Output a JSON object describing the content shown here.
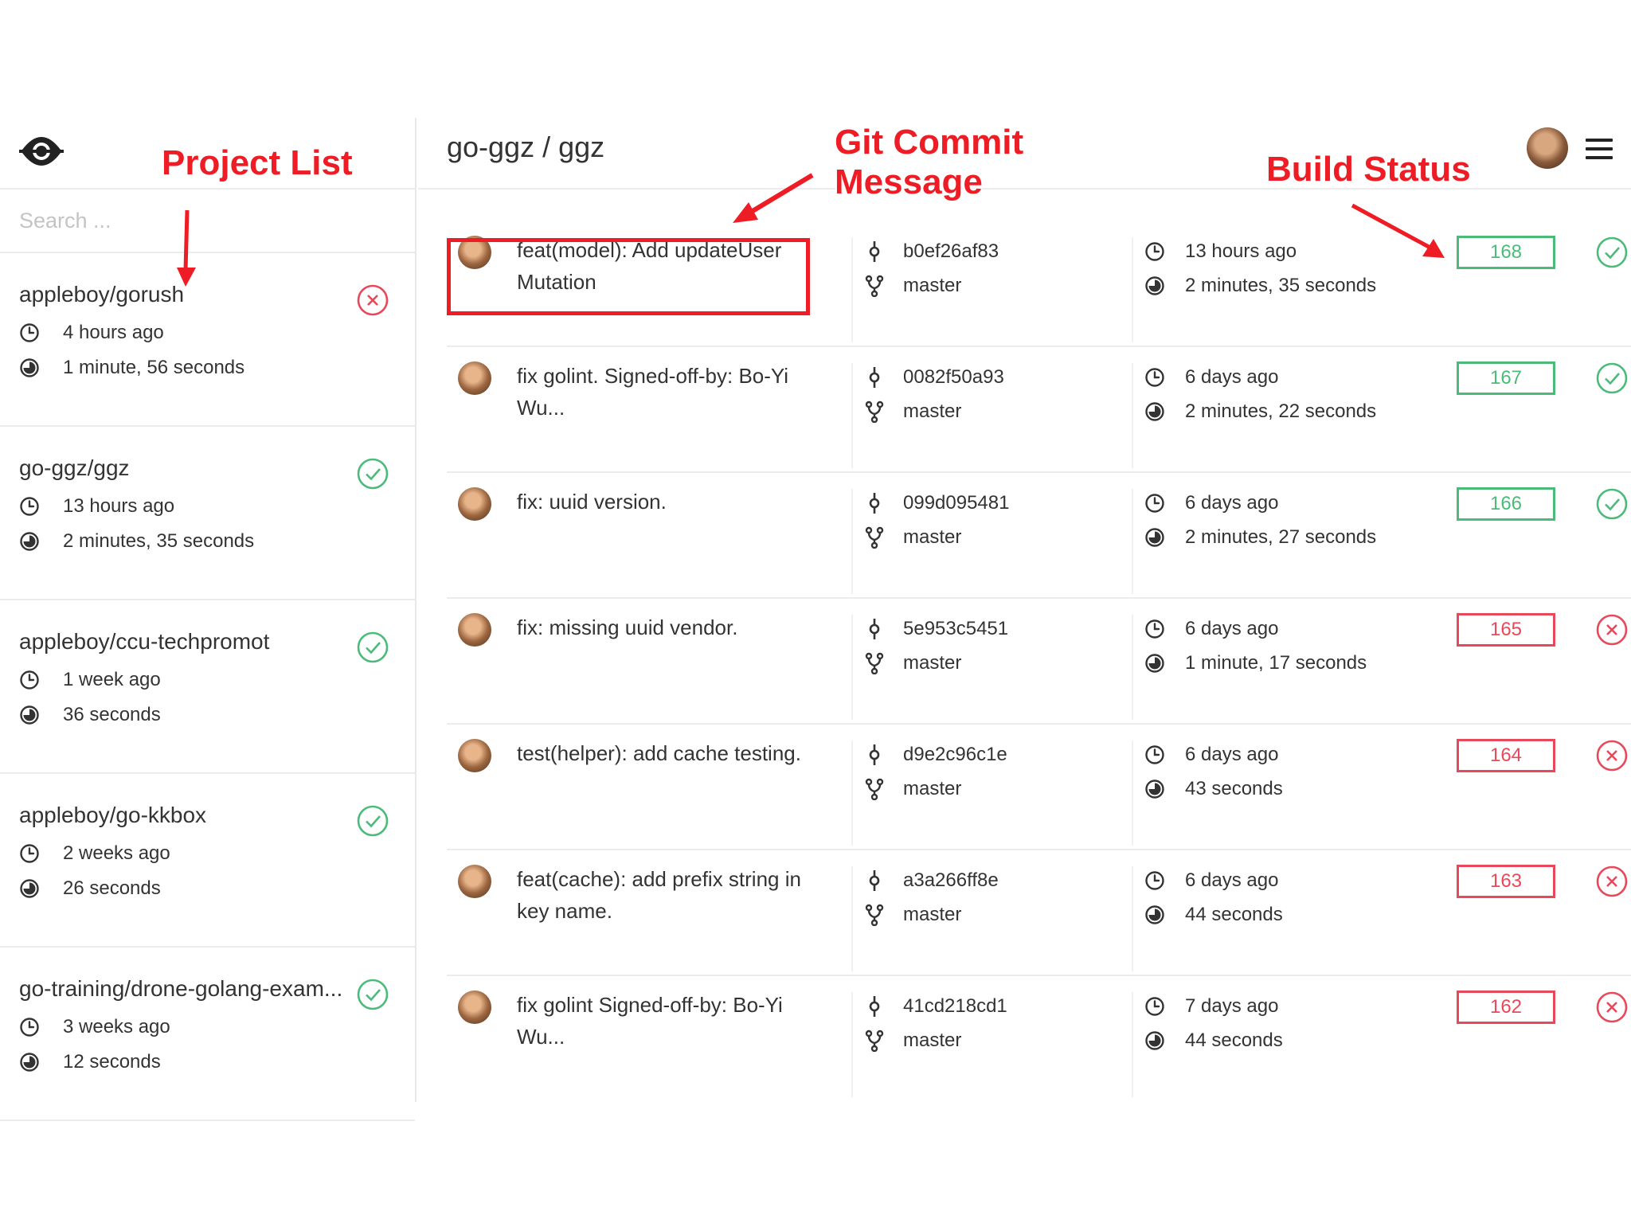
{
  "search": {
    "placeholder": "Search ..."
  },
  "repo_title": "go-ggz / ggz",
  "colors": {
    "success": "#4cbb7a",
    "failure": "#e8495a",
    "annotation": "#ee1c24"
  },
  "projects": [
    {
      "name": "appleboy/gorush",
      "status": "failure",
      "time": "4 hours ago",
      "duration": "1 minute, 56 seconds"
    },
    {
      "name": "go-ggz/ggz",
      "status": "success",
      "time": "13 hours ago",
      "duration": "2 minutes, 35 seconds"
    },
    {
      "name": "appleboy/ccu-techpromot",
      "status": "success",
      "time": "1 week ago",
      "duration": "36 seconds"
    },
    {
      "name": "appleboy/go-kkbox",
      "status": "success",
      "time": "2 weeks ago",
      "duration": "26 seconds"
    },
    {
      "name": "go-training/drone-golang-exam...",
      "status": "success",
      "time": "3 weeks ago",
      "duration": "12 seconds"
    }
  ],
  "builds": [
    {
      "message": "feat(model): Add updateUser Mutation",
      "sha": "b0ef26af83",
      "branch": "master",
      "time": "13 hours ago",
      "duration": "2 minutes, 35 seconds",
      "number": "168",
      "status": "success"
    },
    {
      "message": "fix golint. Signed-off-by: Bo-Yi Wu...",
      "sha": "0082f50a93",
      "branch": "master",
      "time": "6 days ago",
      "duration": "2 minutes, 22 seconds",
      "number": "167",
      "status": "success"
    },
    {
      "message": "fix: uuid version.",
      "sha": "099d095481",
      "branch": "master",
      "time": "6 days ago",
      "duration": "2 minutes, 27 seconds",
      "number": "166",
      "status": "success"
    },
    {
      "message": "fix: missing uuid vendor.",
      "sha": "5e953c5451",
      "branch": "master",
      "time": "6 days ago",
      "duration": "1 minute, 17 seconds",
      "number": "165",
      "status": "failure"
    },
    {
      "message": "test(helper): add cache testing.",
      "sha": "d9e2c96c1e",
      "branch": "master",
      "time": "6 days ago",
      "duration": "43 seconds",
      "number": "164",
      "status": "failure"
    },
    {
      "message": "feat(cache): add prefix string in key name.",
      "sha": "a3a266ff8e",
      "branch": "master",
      "time": "6 days ago",
      "duration": "44 seconds",
      "number": "163",
      "status": "failure"
    },
    {
      "message": "fix golint Signed-off-by: Bo-Yi Wu...",
      "sha": "41cd218cd1",
      "branch": "master",
      "time": "7 days ago",
      "duration": "44 seconds",
      "number": "162",
      "status": "failure"
    }
  ],
  "annotations": {
    "project_list": "Project List",
    "commit_message_line1": "Git Commit",
    "commit_message_line2": "Message",
    "build_status": "Build Status"
  }
}
